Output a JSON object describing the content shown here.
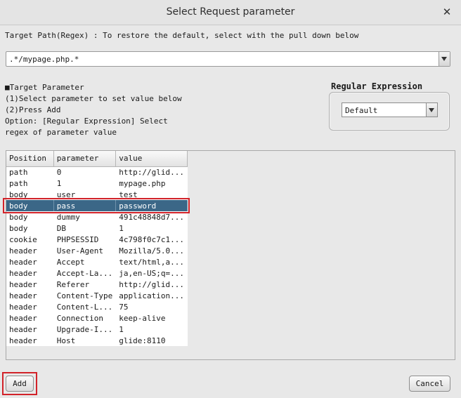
{
  "window": {
    "title": "Select Request parameter",
    "close_glyph": "✕"
  },
  "target_path": {
    "label": "Target Path(Regex) :  To restore the default, select with the pull down below",
    "value": ".*/mypage.php.*"
  },
  "instructions": [
    "■Target Parameter",
    "(1)Select parameter to set value below",
    "(2)Press Add",
    "Option: [Regular Expression] Select",
    "regex of parameter value"
  ],
  "regex": {
    "title": "Regular Expression",
    "selected": "Default"
  },
  "table": {
    "columns": [
      "Position",
      "parameter",
      "value"
    ],
    "selected_index": 3,
    "rows": [
      [
        "path",
        "0",
        "http://glid..."
      ],
      [
        "path",
        "1",
        "mypage.php"
      ],
      [
        "body",
        "user",
        "test"
      ],
      [
        "body",
        "pass",
        "password"
      ],
      [
        "body",
        "dummy",
        "491c48848d7..."
      ],
      [
        "body",
        "DB",
        "1"
      ],
      [
        "cookie",
        "PHPSESSID",
        "4c798f0c7c1..."
      ],
      [
        "header",
        "User-Agent",
        "Mozilla/5.0..."
      ],
      [
        "header",
        "Accept",
        "text/html,a..."
      ],
      [
        "header",
        "Accept-La...",
        "ja,en-US;q=..."
      ],
      [
        "header",
        "Referer",
        "http://glid..."
      ],
      [
        "header",
        "Content-Type",
        "application..."
      ],
      [
        "header",
        "Content-L...",
        "75"
      ],
      [
        "header",
        "Connection",
        "keep-alive"
      ],
      [
        "header",
        "Upgrade-I...",
        "1"
      ],
      [
        "header",
        "Host",
        "glide:8110"
      ]
    ]
  },
  "buttons": {
    "add": "Add",
    "cancel": "Cancel"
  },
  "colors": {
    "selection": "#3b6787",
    "highlight": "#d2232a"
  }
}
